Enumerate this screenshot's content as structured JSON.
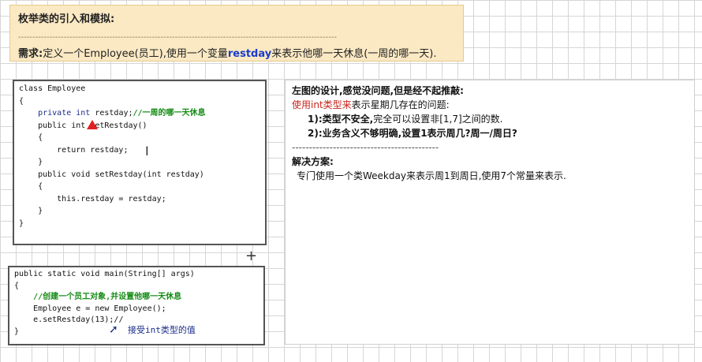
{
  "note": {
    "title": "枚举类的引入和模拟:",
    "divider": "----------------------------------------------------------------------------------------------------------------",
    "req_label": "需求:",
    "req_text_1": "定义一个Employee(员工),使用一个变量",
    "req_var": "restday",
    "req_text_2": "来表示他哪一天休息(一周的哪一天)."
  },
  "code1": {
    "lines": [
      "class Employee",
      "{",
      "    private int restday;//一周的哪一天休息",
      "",
      "    public int getRestday()",
      "    {",
      "        return restday;",
      "    }",
      "    public void setRestday(int restday)",
      "    {",
      "        this.restday = restday;",
      "    }",
      "}"
    ]
  },
  "code2": {
    "lines": [
      "public static void main(String[] args)",
      "{",
      "    //创建一个员工对象,并设置他哪一天休息",
      "    Employee e = new Employee();",
      "    e.setRestday(13);//",
      "}"
    ],
    "annotation": "接受int类型的值"
  },
  "panel": {
    "heading": "左图的设计,感觉没问题,但是经不起推敲:",
    "problem_red": "使用int类型来",
    "problem_rest": "表示星期几存在的问题:",
    "p1_bold": "1):类型不安全,",
    "p1_rest": "完全可以设置非[1,7]之间的数.",
    "p2": "2):业务含义不够明确,设置1表示周几?周一/周日?",
    "divider": "-------------------------------------------",
    "solution_title": "解决方案:",
    "solution_text": "专门使用一个类Weekday来表示周1到周日,使用7个常量来表示."
  }
}
